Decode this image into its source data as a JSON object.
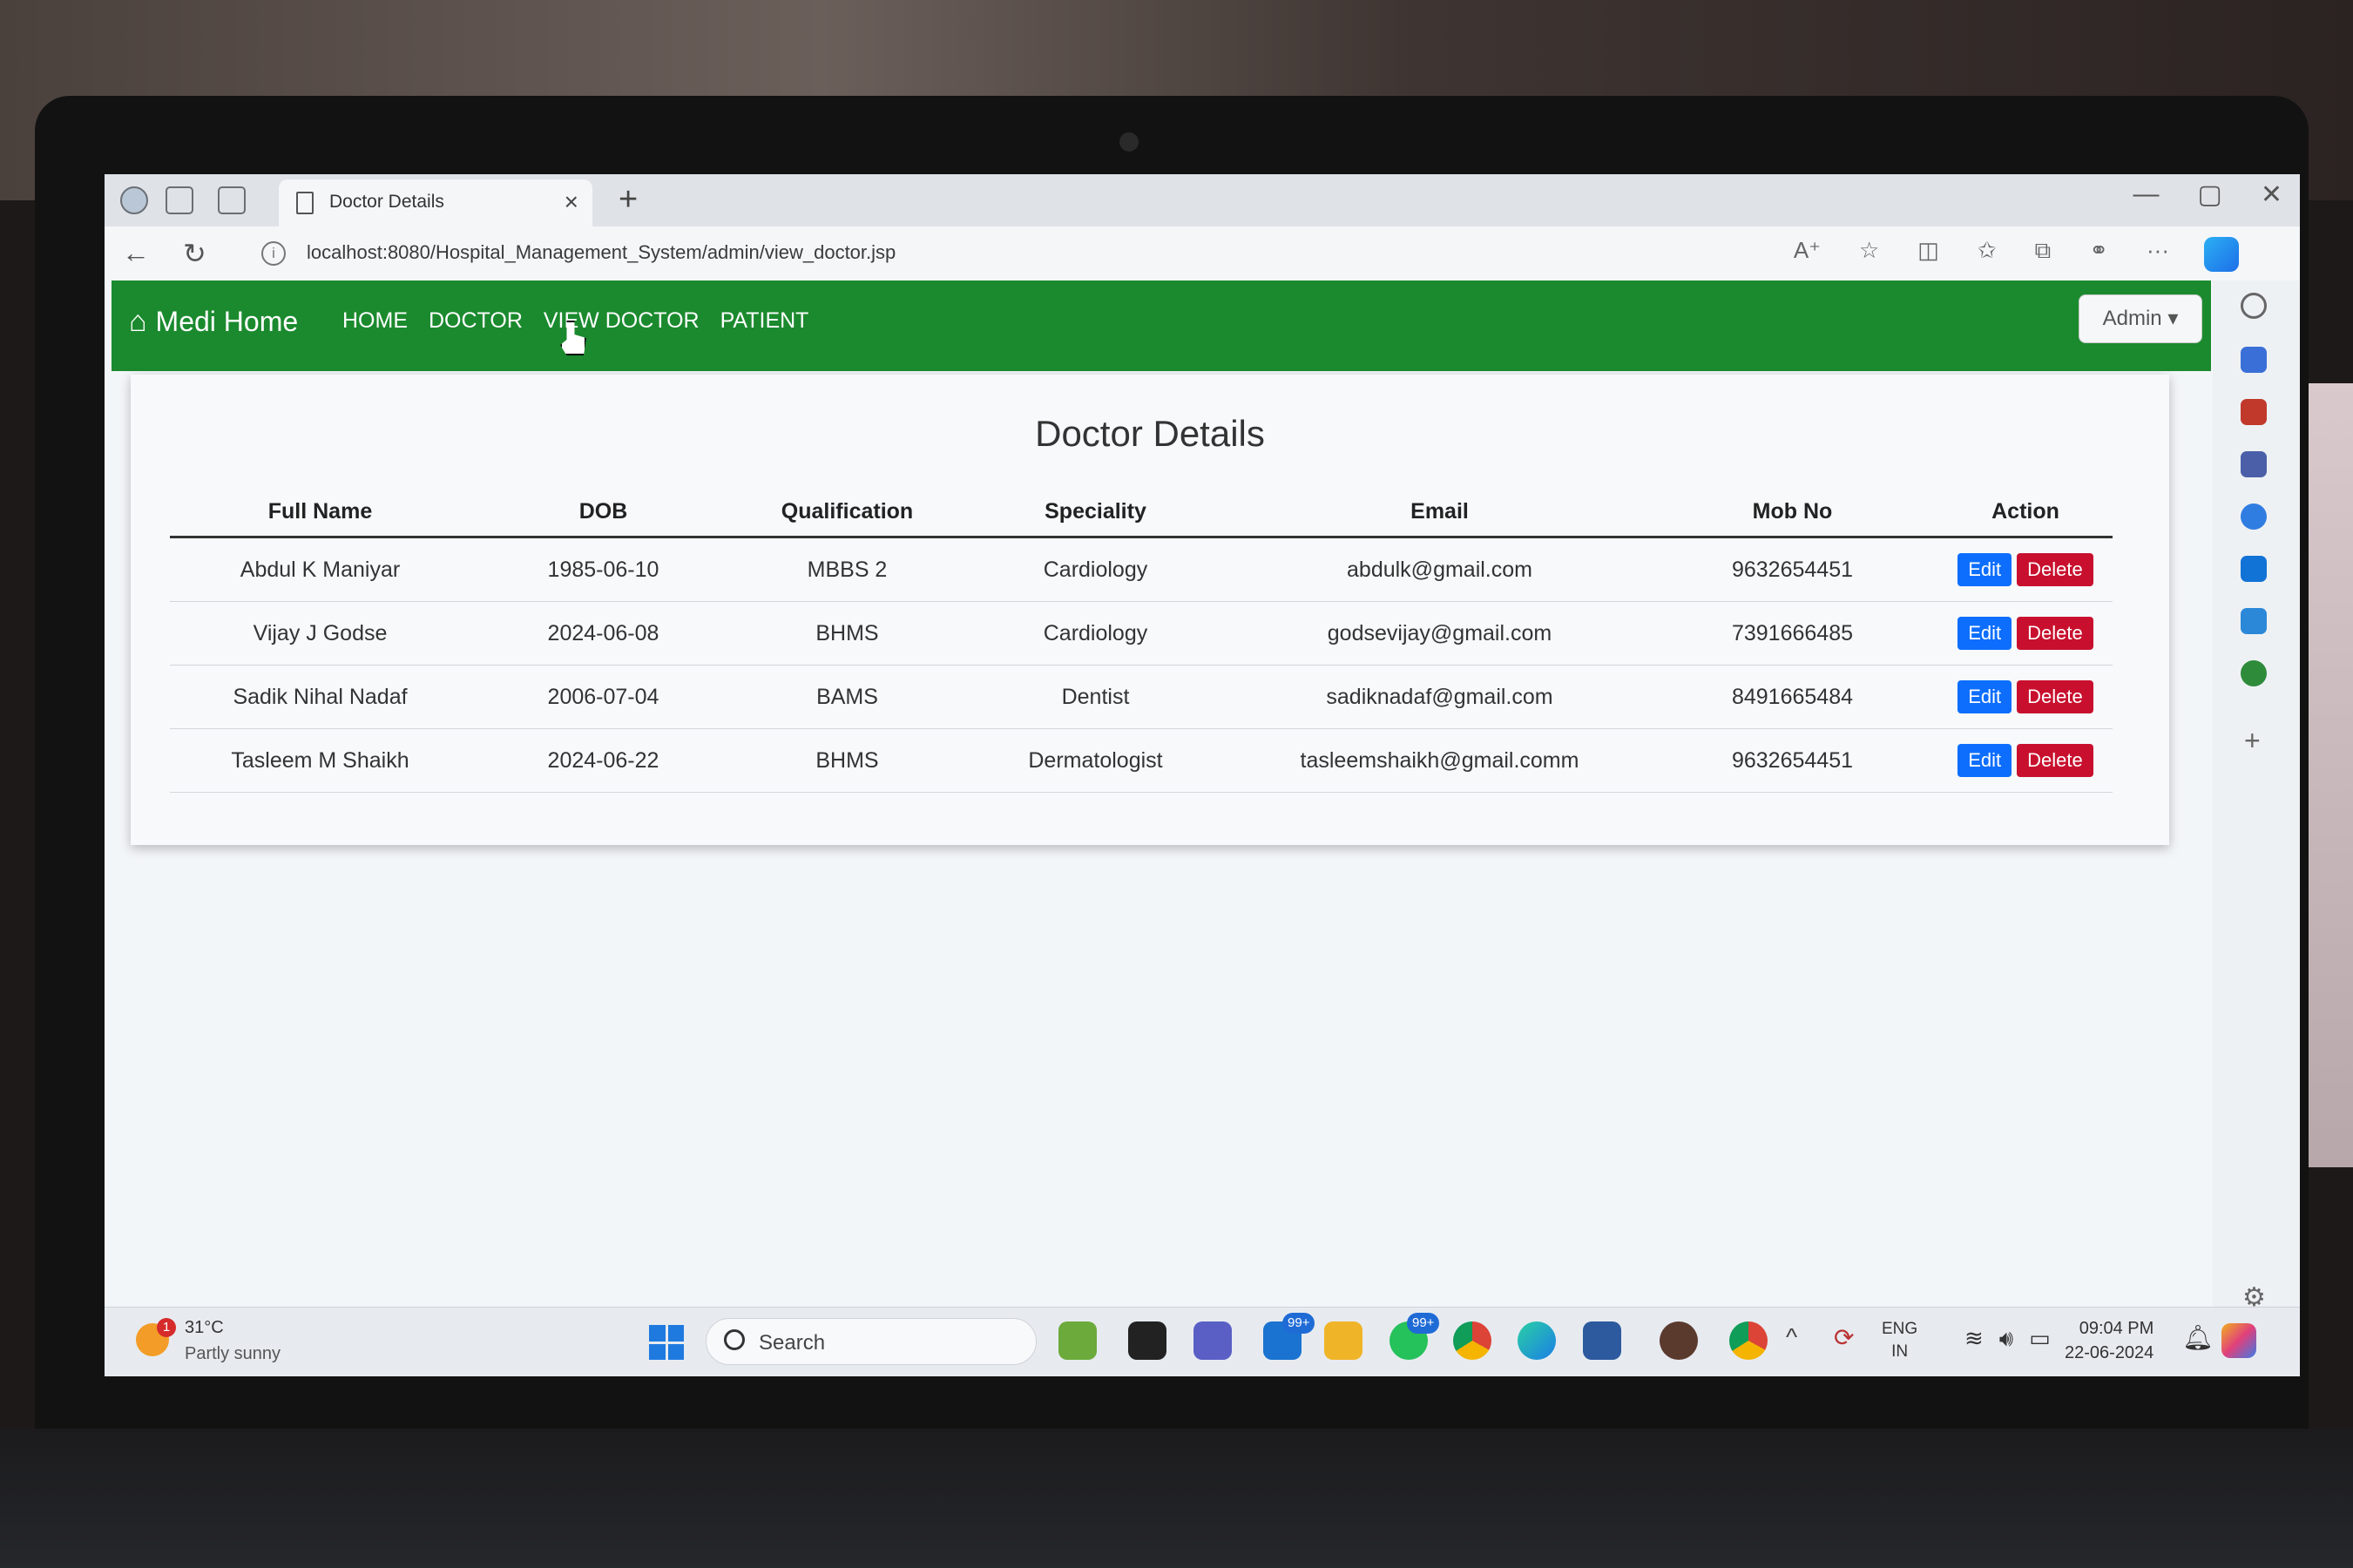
{
  "browser": {
    "tab_title": "Doctor Details",
    "tab_close": "×",
    "new_tab": "+",
    "url": "localhost:8080/Hospital_Management_System/admin/view_doctor.jsp",
    "back": "←",
    "reload": "↻",
    "info": "i",
    "tools": [
      "A⁺",
      "☆",
      "◫",
      "✩",
      "⧉",
      "⚭",
      "···"
    ],
    "window_controls": [
      "—",
      "▢",
      "✕"
    ]
  },
  "navbar": {
    "brand": "Medi Home",
    "links": [
      "HOME",
      "DOCTOR",
      "VIEW DOCTOR",
      "PATIENT"
    ],
    "admin_label": "Admin ▾"
  },
  "card": {
    "title": "Doctor Details",
    "columns": [
      "Full Name",
      "DOB",
      "Qualification",
      "Speciality",
      "Email",
      "Mob No",
      "Action"
    ],
    "rows": [
      {
        "name": "Abdul K Maniyar",
        "dob": "1985-06-10",
        "qualification": "MBBS 2",
        "speciality": "Cardiology",
        "email": "abdulk@gmail.com",
        "mobile": "9632654451"
      },
      {
        "name": "Vijay J Godse",
        "dob": "2024-06-08",
        "qualification": "BHMS",
        "speciality": "Cardiology",
        "email": "godsevijay@gmail.com",
        "mobile": "7391666485"
      },
      {
        "name": "Sadik Nihal Nadaf",
        "dob": "2006-07-04",
        "qualification": "BAMS",
        "speciality": "Dentist",
        "email": "sadiknadaf@gmail.com",
        "mobile": "8491665484"
      },
      {
        "name": "Tasleem M Shaikh",
        "dob": "2024-06-22",
        "qualification": "BHMS",
        "speciality": "Dermatologist",
        "email": "tasleemshaikh@gmail.comm",
        "mobile": "9632654451"
      }
    ],
    "edit_label": "Edit",
    "delete_label": "Delete"
  },
  "sidebar": {
    "plus": "+",
    "gear": "⚙"
  },
  "taskbar": {
    "weather_badge": "1",
    "temperature": "31°C",
    "weather": "Partly sunny",
    "search_label": "Search",
    "mail_badge": "99+",
    "whatsapp_badge": "99+",
    "tray_arrow": "^",
    "lang_line1": "ENG",
    "lang_line2": "IN",
    "tray_symbols": [
      "⟳",
      "≋",
      "🔊︎",
      "▭"
    ],
    "time": "09:04 PM",
    "date": "22-06-2024",
    "bell": "🔔︎"
  },
  "colors": {
    "navbar": "#1b8a2e",
    "edit_button": "#0d6efd",
    "delete_button": "#c8102e"
  }
}
